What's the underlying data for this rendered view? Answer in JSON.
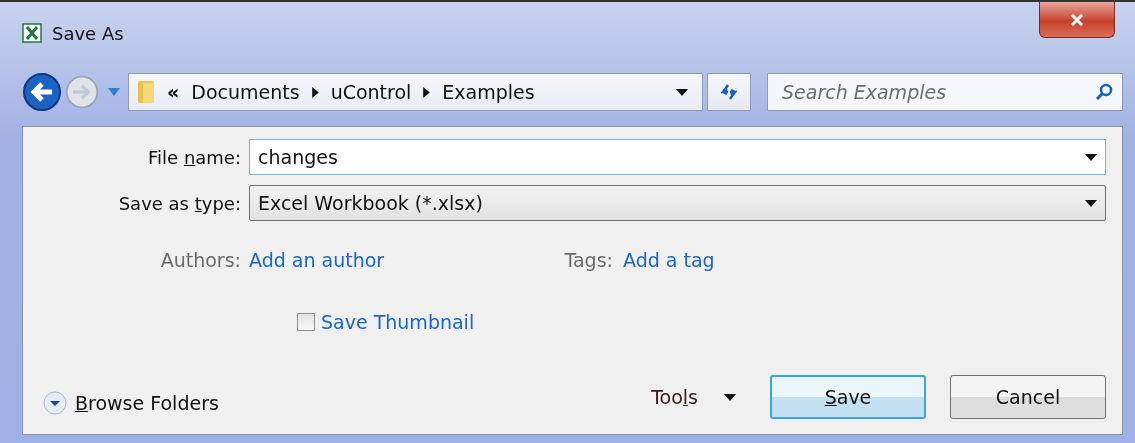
{
  "window": {
    "title": "Save As"
  },
  "address_bar": {
    "overflow": "«",
    "path": [
      "Documents",
      "uControl",
      "Examples"
    ]
  },
  "search": {
    "placeholder": "Search Examples"
  },
  "file_name": {
    "label": [
      "File ",
      "n",
      "ame:"
    ],
    "value": "changes"
  },
  "save_as_type": {
    "label": [
      "Save as ",
      "t",
      "ype:"
    ],
    "value": "Excel Workbook (*.xlsx)"
  },
  "authors": {
    "label": "Authors:",
    "link": "Add an author"
  },
  "tags": {
    "label": "Tags:",
    "link": "Add a tag"
  },
  "save_thumbnail": {
    "label": "Save Thumbnail",
    "checked": false
  },
  "browse_folders": {
    "label": {
      "key": "B",
      "after": "rowse Folders"
    }
  },
  "tools": {
    "label": [
      "Too",
      "l",
      "s"
    ]
  },
  "buttons": [
    {
      "label": {
        "key": "S",
        "after": "ave"
      },
      "default": true
    },
    {
      "label": {
        "before": "Cancel"
      },
      "default": false
    }
  ]
}
